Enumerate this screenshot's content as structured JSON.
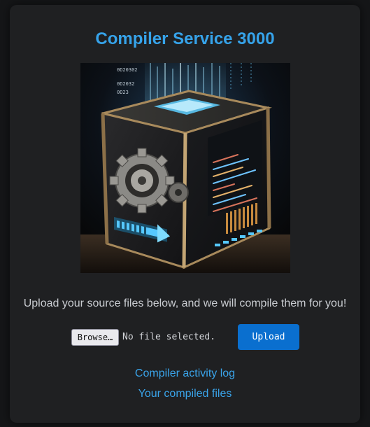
{
  "header": {
    "title": "Compiler Service 3000"
  },
  "hero": {
    "image_icon": "compiler-box-illustration-icon",
    "code_digits": [
      "0D20302",
      "0D2032",
      "0D23"
    ],
    "colors": {
      "glow": "#4fc3f7",
      "brass": "#a88a5c",
      "dark": "#1a1a1c"
    }
  },
  "upload": {
    "instructions": "Upload your source files below, and we will compile them for you!",
    "browse_label": "Browse…",
    "file_status": "No file selected.",
    "submit_label": "Upload"
  },
  "links": {
    "activity_log": "Compiler activity log",
    "compiled_files": "Your compiled files"
  },
  "colors": {
    "accent": "#36a3ea",
    "button": "#0a6fcf",
    "card": "#1f2022",
    "page": "#151618"
  }
}
